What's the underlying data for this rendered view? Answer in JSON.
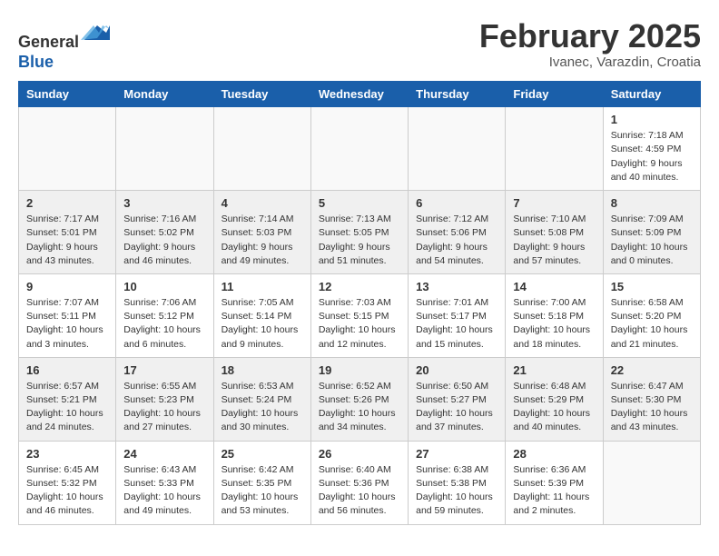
{
  "header": {
    "logo_line1": "General",
    "logo_line2": "Blue",
    "month_title": "February 2025",
    "location": "Ivanec, Varazdin, Croatia"
  },
  "weekdays": [
    "Sunday",
    "Monday",
    "Tuesday",
    "Wednesday",
    "Thursday",
    "Friday",
    "Saturday"
  ],
  "weeks": [
    {
      "shaded": false,
      "days": [
        {
          "num": "",
          "info": ""
        },
        {
          "num": "",
          "info": ""
        },
        {
          "num": "",
          "info": ""
        },
        {
          "num": "",
          "info": ""
        },
        {
          "num": "",
          "info": ""
        },
        {
          "num": "",
          "info": ""
        },
        {
          "num": "1",
          "info": "Sunrise: 7:18 AM\nSunset: 4:59 PM\nDaylight: 9 hours and 40 minutes."
        }
      ]
    },
    {
      "shaded": true,
      "days": [
        {
          "num": "2",
          "info": "Sunrise: 7:17 AM\nSunset: 5:01 PM\nDaylight: 9 hours and 43 minutes."
        },
        {
          "num": "3",
          "info": "Sunrise: 7:16 AM\nSunset: 5:02 PM\nDaylight: 9 hours and 46 minutes."
        },
        {
          "num": "4",
          "info": "Sunrise: 7:14 AM\nSunset: 5:03 PM\nDaylight: 9 hours and 49 minutes."
        },
        {
          "num": "5",
          "info": "Sunrise: 7:13 AM\nSunset: 5:05 PM\nDaylight: 9 hours and 51 minutes."
        },
        {
          "num": "6",
          "info": "Sunrise: 7:12 AM\nSunset: 5:06 PM\nDaylight: 9 hours and 54 minutes."
        },
        {
          "num": "7",
          "info": "Sunrise: 7:10 AM\nSunset: 5:08 PM\nDaylight: 9 hours and 57 minutes."
        },
        {
          "num": "8",
          "info": "Sunrise: 7:09 AM\nSunset: 5:09 PM\nDaylight: 10 hours and 0 minutes."
        }
      ]
    },
    {
      "shaded": false,
      "days": [
        {
          "num": "9",
          "info": "Sunrise: 7:07 AM\nSunset: 5:11 PM\nDaylight: 10 hours and 3 minutes."
        },
        {
          "num": "10",
          "info": "Sunrise: 7:06 AM\nSunset: 5:12 PM\nDaylight: 10 hours and 6 minutes."
        },
        {
          "num": "11",
          "info": "Sunrise: 7:05 AM\nSunset: 5:14 PM\nDaylight: 10 hours and 9 minutes."
        },
        {
          "num": "12",
          "info": "Sunrise: 7:03 AM\nSunset: 5:15 PM\nDaylight: 10 hours and 12 minutes."
        },
        {
          "num": "13",
          "info": "Sunrise: 7:01 AM\nSunset: 5:17 PM\nDaylight: 10 hours and 15 minutes."
        },
        {
          "num": "14",
          "info": "Sunrise: 7:00 AM\nSunset: 5:18 PM\nDaylight: 10 hours and 18 minutes."
        },
        {
          "num": "15",
          "info": "Sunrise: 6:58 AM\nSunset: 5:20 PM\nDaylight: 10 hours and 21 minutes."
        }
      ]
    },
    {
      "shaded": true,
      "days": [
        {
          "num": "16",
          "info": "Sunrise: 6:57 AM\nSunset: 5:21 PM\nDaylight: 10 hours and 24 minutes."
        },
        {
          "num": "17",
          "info": "Sunrise: 6:55 AM\nSunset: 5:23 PM\nDaylight: 10 hours and 27 minutes."
        },
        {
          "num": "18",
          "info": "Sunrise: 6:53 AM\nSunset: 5:24 PM\nDaylight: 10 hours and 30 minutes."
        },
        {
          "num": "19",
          "info": "Sunrise: 6:52 AM\nSunset: 5:26 PM\nDaylight: 10 hours and 34 minutes."
        },
        {
          "num": "20",
          "info": "Sunrise: 6:50 AM\nSunset: 5:27 PM\nDaylight: 10 hours and 37 minutes."
        },
        {
          "num": "21",
          "info": "Sunrise: 6:48 AM\nSunset: 5:29 PM\nDaylight: 10 hours and 40 minutes."
        },
        {
          "num": "22",
          "info": "Sunrise: 6:47 AM\nSunset: 5:30 PM\nDaylight: 10 hours and 43 minutes."
        }
      ]
    },
    {
      "shaded": false,
      "days": [
        {
          "num": "23",
          "info": "Sunrise: 6:45 AM\nSunset: 5:32 PM\nDaylight: 10 hours and 46 minutes."
        },
        {
          "num": "24",
          "info": "Sunrise: 6:43 AM\nSunset: 5:33 PM\nDaylight: 10 hours and 49 minutes."
        },
        {
          "num": "25",
          "info": "Sunrise: 6:42 AM\nSunset: 5:35 PM\nDaylight: 10 hours and 53 minutes."
        },
        {
          "num": "26",
          "info": "Sunrise: 6:40 AM\nSunset: 5:36 PM\nDaylight: 10 hours and 56 minutes."
        },
        {
          "num": "27",
          "info": "Sunrise: 6:38 AM\nSunset: 5:38 PM\nDaylight: 10 hours and 59 minutes."
        },
        {
          "num": "28",
          "info": "Sunrise: 6:36 AM\nSunset: 5:39 PM\nDaylight: 11 hours and 2 minutes."
        },
        {
          "num": "",
          "info": ""
        }
      ]
    }
  ]
}
